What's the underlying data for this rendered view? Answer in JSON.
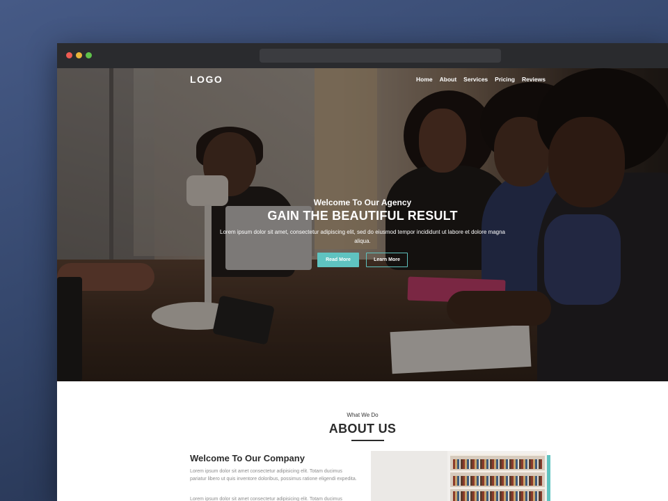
{
  "nav": {
    "logo": "LOGO",
    "items": [
      "Home",
      "About",
      "Services",
      "Pricing",
      "Reviews"
    ]
  },
  "hero": {
    "eyebrow": "Welcome To Our Agency",
    "headline": "GAIN THE BEAUTIFUL RESULT",
    "subtext": "Lorem ipsum dolor sit amet, consectetur adipiscing elit, sed do eiusmod tempor incididunt ut labore et dolore magna aliqua.",
    "primary_button": "Read More",
    "secondary_button": "Learn More"
  },
  "about": {
    "eyebrow": "What We Do",
    "title": "ABOUT US",
    "company_title": "Welcome To Our Company",
    "paragraph1": "Lorem ipsum dolor sit amet consectetur adipisicing elit. Totam ducimus pariatur libero ut quis inventore doloribus, possimus ratione eligendi expedita.",
    "paragraph2": "Lorem ipsum dolor sit amet consectetur adipisicing elit. Totam ducimus"
  },
  "colors": {
    "accent": "#5fc3c0",
    "titlebar": "#2a2b2e",
    "background": "#3a4c74"
  }
}
